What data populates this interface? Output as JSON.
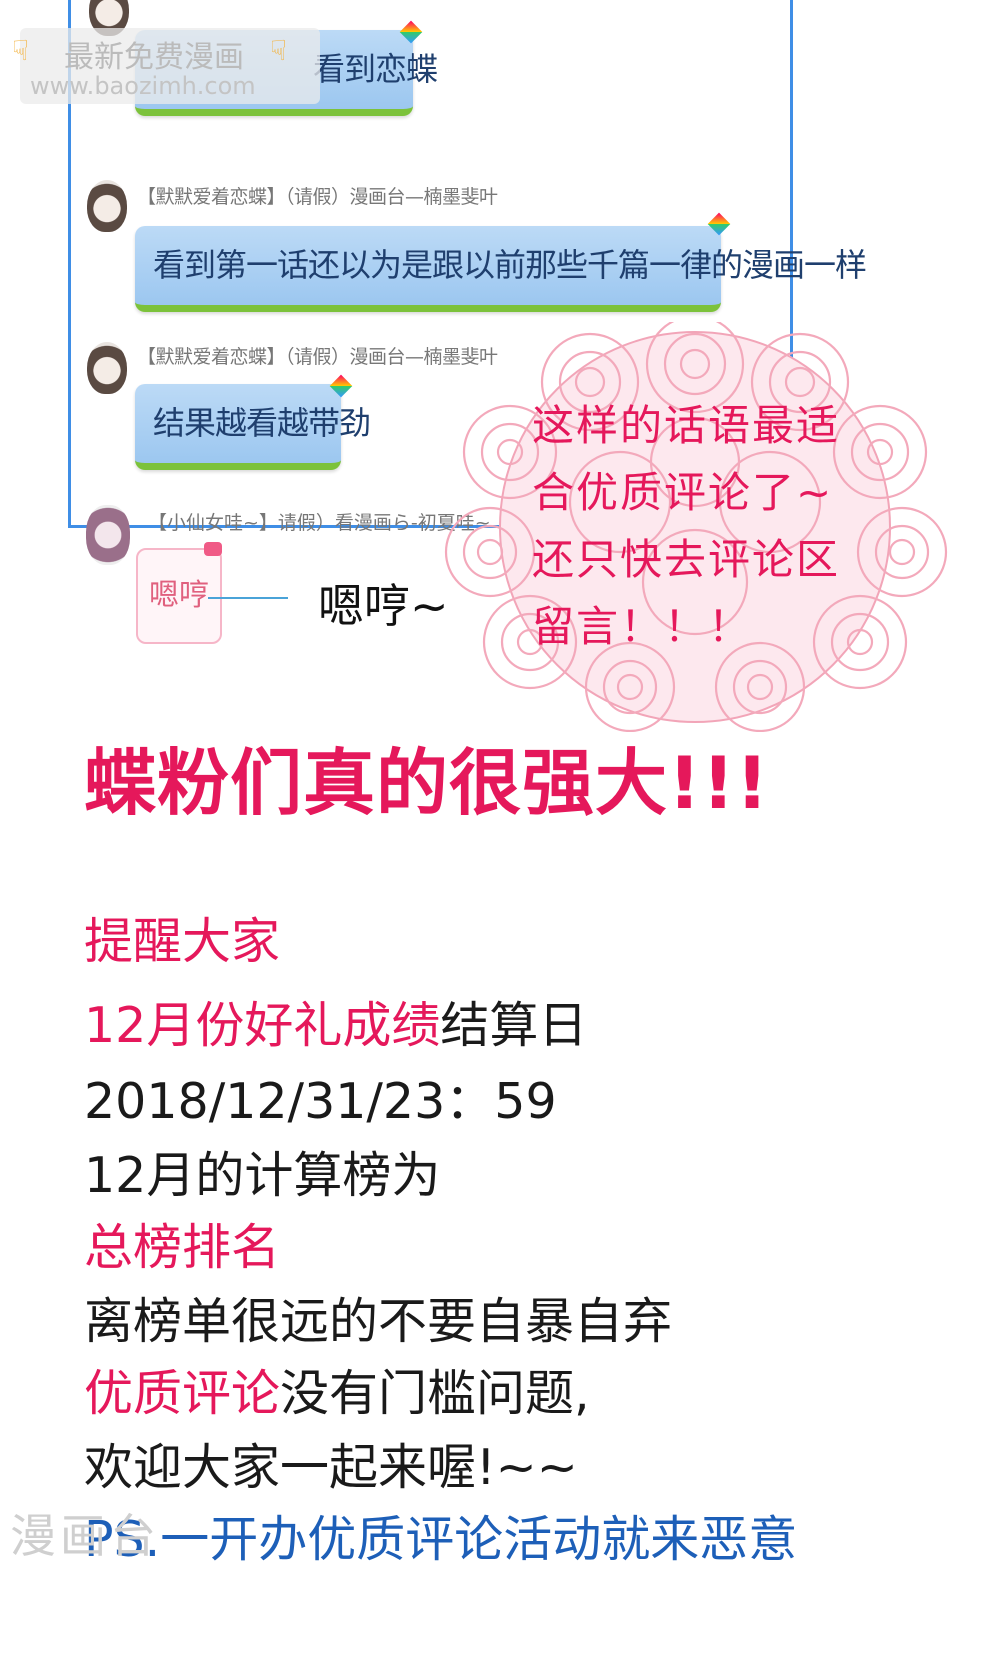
{
  "watermark_top": {
    "line1": "最新免费漫画",
    "line2": "www.baozimh.com"
  },
  "chat": [
    {
      "sender": "",
      "text": "看到恋蝶"
    },
    {
      "sender": "【默默爱着恋蝶】（请假）漫画台—楠墨斐叶",
      "text": "看到第一话还以为是跟以前那些千篇一律的漫画一样"
    },
    {
      "sender": "【默默爱着恋蝶】（请假）漫画台—楠墨斐叶",
      "text": "结果越看越带劲"
    }
  ],
  "pink_chat": {
    "sender": "【小仙女哇~】请假）看漫画ら-初夏哇~",
    "text": "嗯哼"
  },
  "annotation": "嗯哼~",
  "rose_text": [
    "这样的话语最适",
    "合优质评论了~",
    "还只快去评论区",
    "留言！！！"
  ],
  "headline": "蝶粉们真的很强大!!!",
  "body": {
    "l1": "提醒大家",
    "l2_red": "12月份好礼成绩",
    "l2_black": "结算日",
    "l3": "2018/12/31/23：59",
    "l4": "12月的计算榜为",
    "l5": "总榜排名",
    "l6": "离榜单很远的不要自暴自弃",
    "l7_red": "优质评论",
    "l7_black": "没有门槛问题,",
    "l8": "欢迎大家一起来喔!~~",
    "l9": "PS.一开办优质评论活动就来恶意"
  },
  "watermark_bottom": "漫画台",
  "colors": {
    "accent": "#e5185b",
    "panel_border": "#3f8ee6",
    "bubble": "#a9cff3",
    "bubble_underline": "#7cc23b"
  }
}
